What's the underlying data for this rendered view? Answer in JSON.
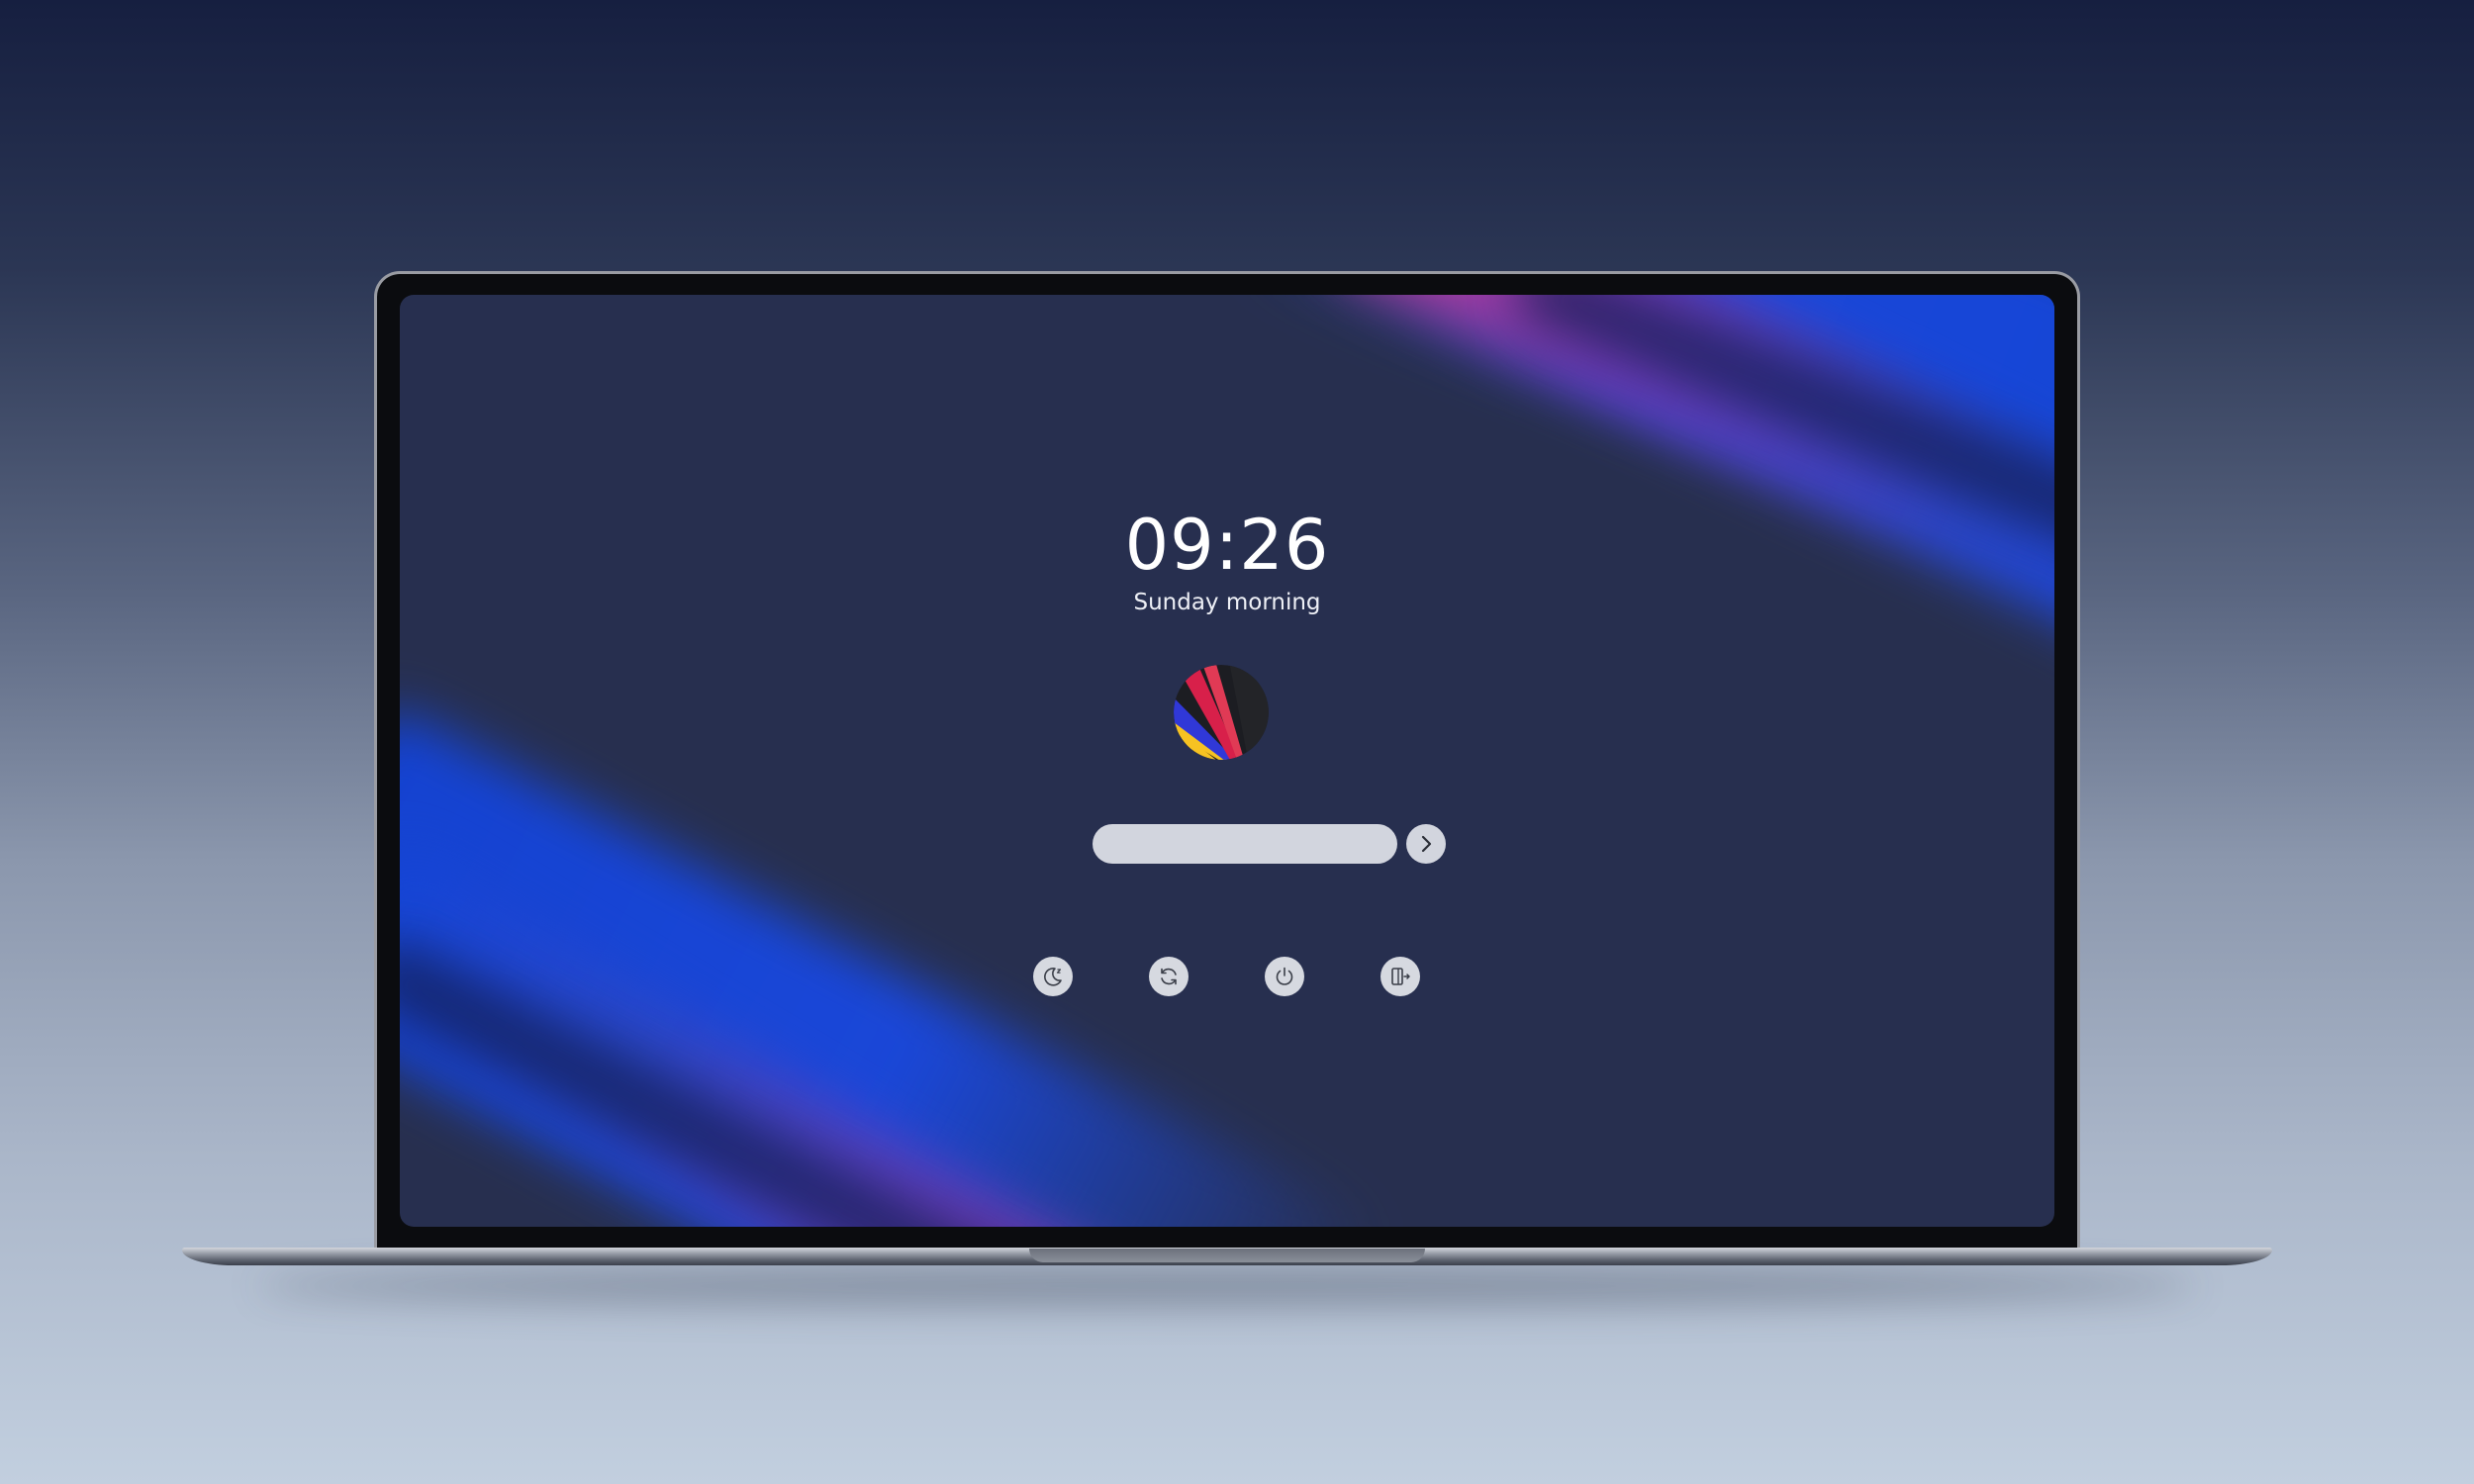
{
  "lock_screen": {
    "time": "09:26",
    "greeting": "Sunday morning",
    "password": {
      "value": "",
      "placeholder": ""
    },
    "submit_icon": "chevron-right-icon",
    "actions": [
      {
        "name": "sleep",
        "icon": "moon-icon"
      },
      {
        "name": "restart",
        "icon": "refresh-icon"
      },
      {
        "name": "shutdown",
        "icon": "power-icon"
      },
      {
        "name": "switch-user",
        "icon": "logout-icon"
      }
    ]
  },
  "colors": {
    "background_top": "#161f40",
    "background_bottom": "#c2cfdf",
    "screen_base": "#272f4f",
    "accent_blue": "#1a47d8",
    "accent_pink": "#c53c8c",
    "field": "#d2d5de",
    "text": "#ffffff"
  }
}
